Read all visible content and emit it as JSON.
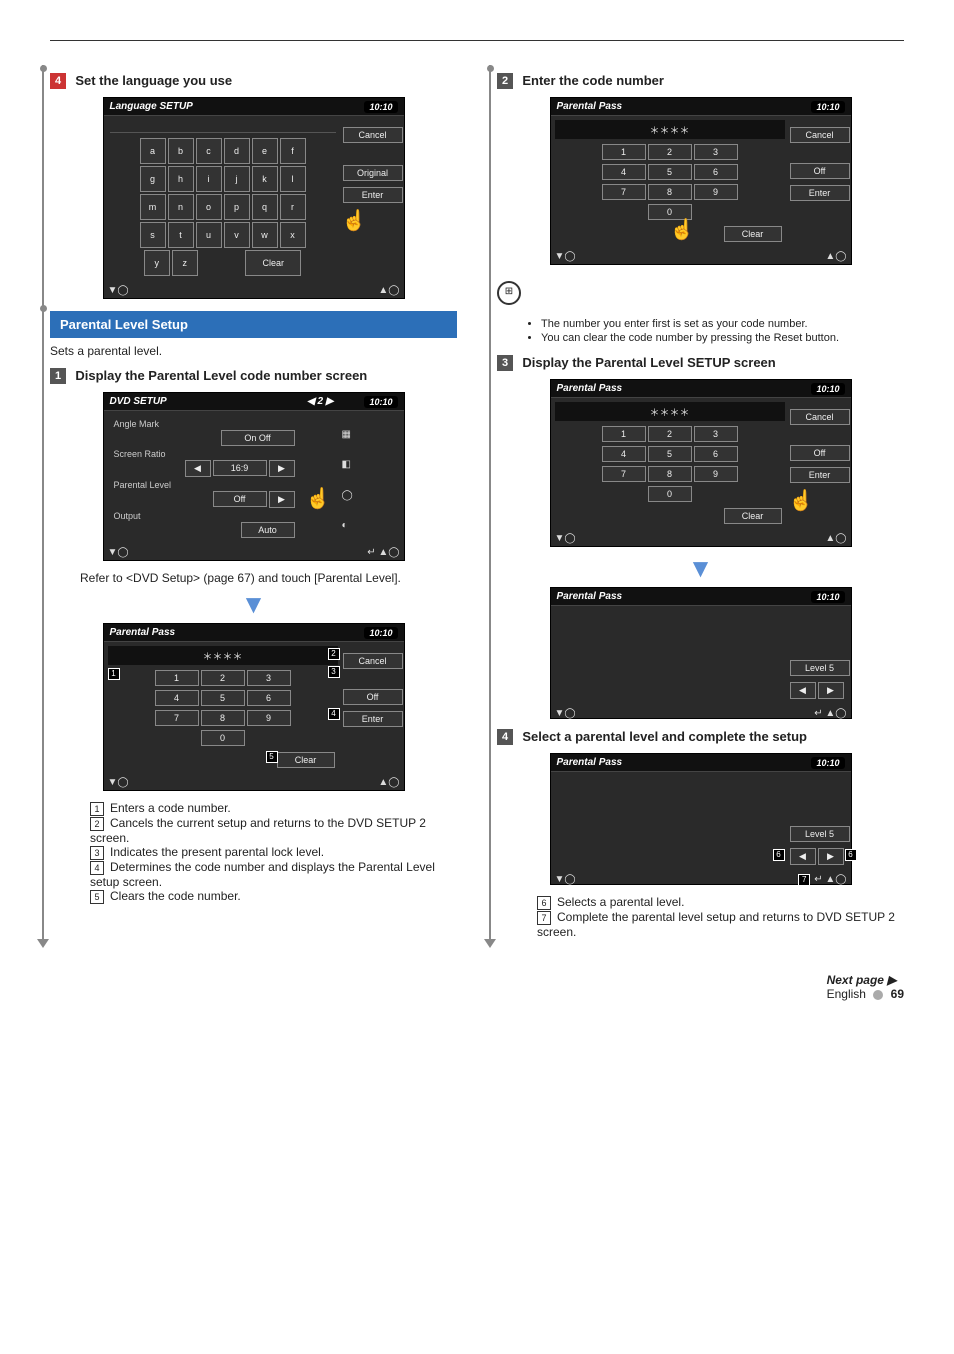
{
  "page": {
    "lang": "English",
    "number": "69",
    "next": "Next page ▶"
  },
  "left": {
    "step4": {
      "num": "4",
      "title": "Set the language you use"
    },
    "langScreen": {
      "title": "Language SETUP",
      "clock": "10:10",
      "letters": [
        "a",
        "b",
        "c",
        "d",
        "e",
        "f",
        "g",
        "h",
        "i",
        "j",
        "k",
        "l",
        "m",
        "n",
        "o",
        "p",
        "q",
        "r",
        "s",
        "t",
        "u",
        "v",
        "w",
        "x",
        "y",
        "z"
      ],
      "clear": "Clear",
      "side": [
        "Cancel",
        "Original",
        "Enter"
      ]
    },
    "parentalSection": {
      "title": "Parental Level Setup",
      "sub": "Sets a parental level."
    },
    "step1": {
      "num": "1",
      "title": "Display the Parental Level code number screen"
    },
    "dvdScreen": {
      "title": "DVD SETUP",
      "clock": "10:10",
      "items": [
        "Angle Mark",
        "Screen Ratio",
        "Parental Level",
        "Output"
      ],
      "vals": [
        "On  Off",
        "16:9",
        "Off",
        "Auto"
      ],
      "page": "2"
    },
    "dvdNote": "Refer to <DVD Setup> (page 67) and touch [Parental Level].",
    "passScreen": {
      "title": "Parental Pass",
      "clock": "10:10",
      "stars": "＊＊＊＊",
      "nums": [
        "1",
        "2",
        "3",
        "4",
        "5",
        "6",
        "7",
        "8",
        "9",
        "0"
      ],
      "clear": "Clear",
      "side": [
        "Cancel",
        "Off",
        "Enter"
      ]
    },
    "legend": {
      "1": "Enters a code number.",
      "2": "Cancels the current setup and returns to the DVD SETUP 2 screen.",
      "3": "Indicates the present parental lock level.",
      "4": "Determines the code number and displays the Parental Level setup screen.",
      "5": "Clears the code number."
    }
  },
  "right": {
    "step2": {
      "num": "2",
      "title": "Enter the code number"
    },
    "pass1": {
      "title": "Parental Pass",
      "clock": "10:10",
      "stars": "＊＊＊＊",
      "nums": [
        "1",
        "2",
        "3",
        "4",
        "5",
        "6",
        "7",
        "8",
        "9",
        "0"
      ],
      "clear": "Clear",
      "side": [
        "Cancel",
        "Off",
        "Enter"
      ]
    },
    "notes": [
      "The number you enter first is set as your code number.",
      "You can clear the code number by pressing the Reset button."
    ],
    "step3": {
      "num": "3",
      "title": "Display the Parental Level SETUP screen"
    },
    "pass2": {
      "title": "Parental Pass",
      "clock": "10:10",
      "stars": "＊＊＊＊",
      "nums": [
        "1",
        "2",
        "3",
        "4",
        "5",
        "6",
        "7",
        "8",
        "9",
        "0"
      ],
      "clear": "Clear",
      "side": [
        "Cancel",
        "Off",
        "Enter"
      ]
    },
    "levelShow": {
      "title": "Parental Pass",
      "clock": "10:10",
      "level": "Level 5"
    },
    "step4": {
      "num": "4",
      "title": "Select a parental level and complete the setup"
    },
    "levelSelect": {
      "title": "Parental Pass",
      "clock": "10:10",
      "level": "Level 5"
    },
    "legend": {
      "6": "Selects a parental level.",
      "7": "Complete the parental level setup and returns to DVD SETUP 2 screen."
    }
  }
}
